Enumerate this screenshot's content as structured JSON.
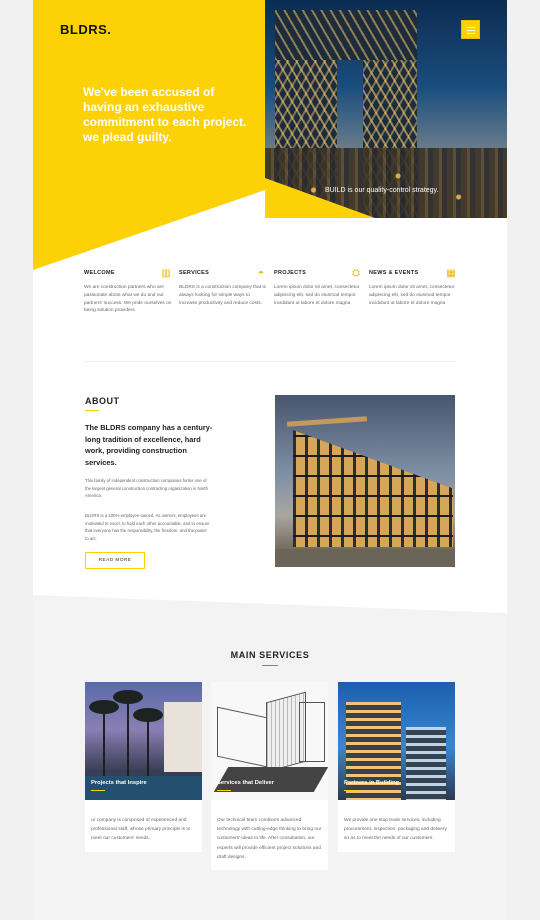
{
  "header": {
    "logo": "BLDRS.",
    "menu_icon": "hamburger-icon"
  },
  "hero": {
    "headline": "We've been accused of having an exhaustive commitment to each project. we plead guilty.",
    "tagline": "BUILD is our quality-control strategy."
  },
  "features": [
    {
      "title": "WELCOME",
      "icon": "building-icon",
      "text": "We are construction partners who are passionate about what we do and our partners' success. We pride ourselves on being solution providers."
    },
    {
      "title": "SERVICES",
      "icon": "helmet-icon",
      "text": "BLDRS is a construction company that is always looking for simple ways to increase productivity and reduce costs."
    },
    {
      "title": "PROJECTS",
      "icon": "crane-icon",
      "text": "Lorem ipsum dolor sit amet, consectetur adipiscing elit, sed do eiusmod tempor incididunt ut labore et dolore magna"
    },
    {
      "title": "NEWS & EVENTS",
      "icon": "truck-icon",
      "text": "Lorem ipsum dolor sit amet, consectetur adipiscing elit, sed do eiusmod tempor incididunt ut labore et dolore magna"
    }
  ],
  "about": {
    "title": "ABOUT",
    "lead": "The BLDRS company has a century-long tradition of excellence, hard work, providing construction services.",
    "p1": "This family of independent construction companies forms one of the largest general construction contracting organization in North America.",
    "p2": "BLDRS is a 100% employee-owned. As owners, employees are motivated to excel, to hold each other accountable, and to ensure that everyone has the responsibility, the freedom, and the power to act.",
    "button": "READ MORE"
  },
  "services": {
    "title": "MAIN SERVICES",
    "cards": [
      {
        "caption": "Projects that Inspire",
        "text": "ur company is comprised of experienced and professional staff, whose primary principle is to meet our customers' needs."
      },
      {
        "caption": "Services that Deliver",
        "text": "Our technical team combines advanced technology with cutting-edge thinking to bring our customers' ideas to life. After consultation, our experts will provide efficient project solutions and draft designs."
      },
      {
        "caption": "Partners in Building",
        "text": "We provide one stop trade services, including procurement, inspection, packaging and delivery so as to meet the needs of our customers."
      }
    ]
  },
  "colors": {
    "accent": "#fcd207",
    "services_underline": "#e5632c"
  }
}
